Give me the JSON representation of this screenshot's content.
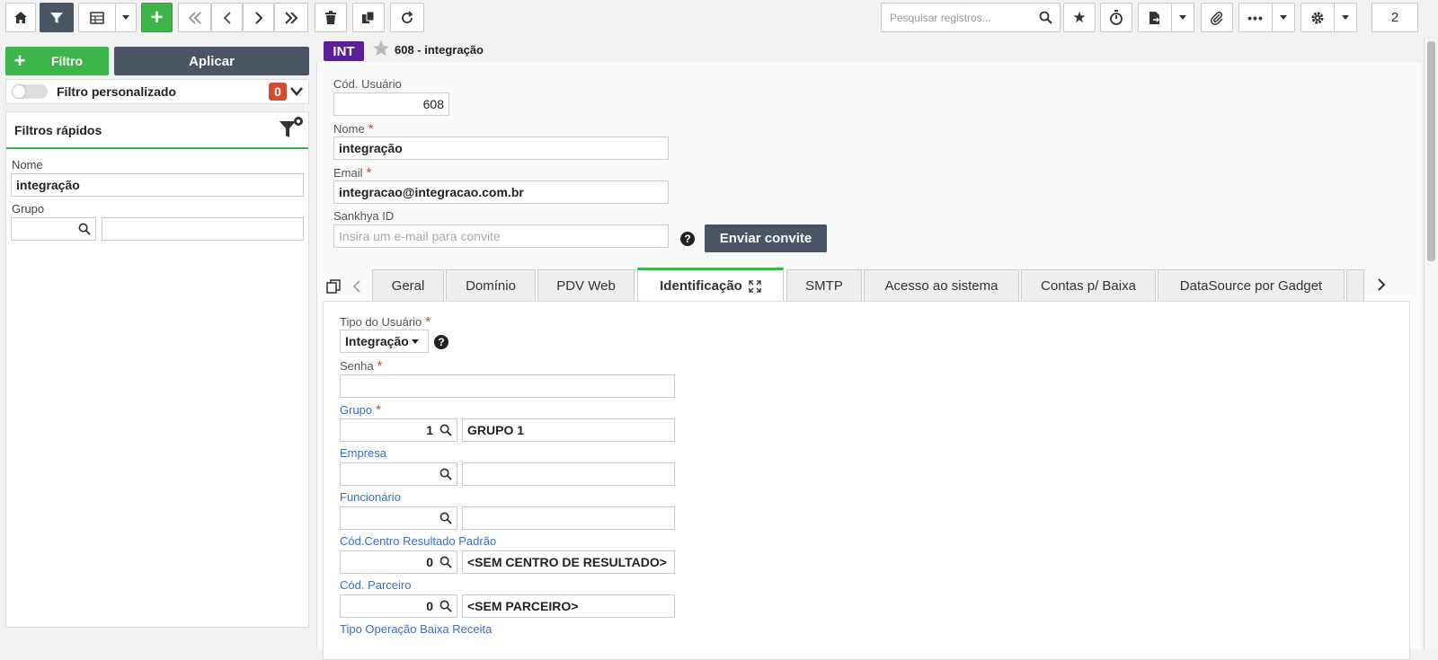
{
  "toolbar": {
    "search_placeholder": "Pesquisar registros...",
    "page_count": "2"
  },
  "filter_panel": {
    "filter_button": "Filtro",
    "apply_button": "Aplicar",
    "custom_filter_label": "Filtro personalizado",
    "custom_filter_count": "0",
    "quick_filters_title": "Filtros rápidos",
    "nome_label": "Nome",
    "nome_value": "integração",
    "grupo_label": "Grupo"
  },
  "record": {
    "badge": "INT",
    "title": "608 - integração"
  },
  "form": {
    "cod_usuario_label": "Cód. Usuário",
    "cod_usuario_value": "608",
    "nome_label": "Nome",
    "nome_value": "integração",
    "email_label": "Email",
    "email_value": "integracao@integracao.com.br",
    "sankhya_label": "Sankhya ID",
    "sankhya_placeholder": "Insira um e-mail para convite",
    "invite_button": "Enviar convite",
    "required_mark": "*",
    "help_mark": "?"
  },
  "tabs": [
    {
      "label": "Geral"
    },
    {
      "label": "Domínio"
    },
    {
      "label": "PDV Web"
    },
    {
      "label": "Identificação"
    },
    {
      "label": "SMTP"
    },
    {
      "label": "Acesso ao sistema"
    },
    {
      "label": "Contas p/ Baixa"
    },
    {
      "label": "DataSource por Gadget"
    }
  ],
  "identificacao": {
    "tipo_label": "Tipo do Usuário",
    "tipo_value": "Integração",
    "senha_label": "Senha",
    "grupo_label": "Grupo",
    "grupo_code": "1",
    "grupo_name": "GRUPO 1",
    "empresa_label": "Empresa",
    "funcionario_label": "Funcionário",
    "centro_label": "Cód.Centro Resultado Padrão",
    "centro_code": "0",
    "centro_name": "<SEM CENTRO DE RESULTADO>",
    "parceiro_label": "Cód. Parceiro",
    "parceiro_code": "0",
    "parceiro_name": "<SEM PARCEIRO>",
    "tipo_operacao_label": "Tipo Operação Baixa Receita"
  },
  "colors": {
    "accent_green": "#3cb54a",
    "dark_button": "#4a5563",
    "int_badge": "#5a1e96",
    "badge_red": "#d64a2e",
    "link_blue": "#3a6fc4"
  }
}
